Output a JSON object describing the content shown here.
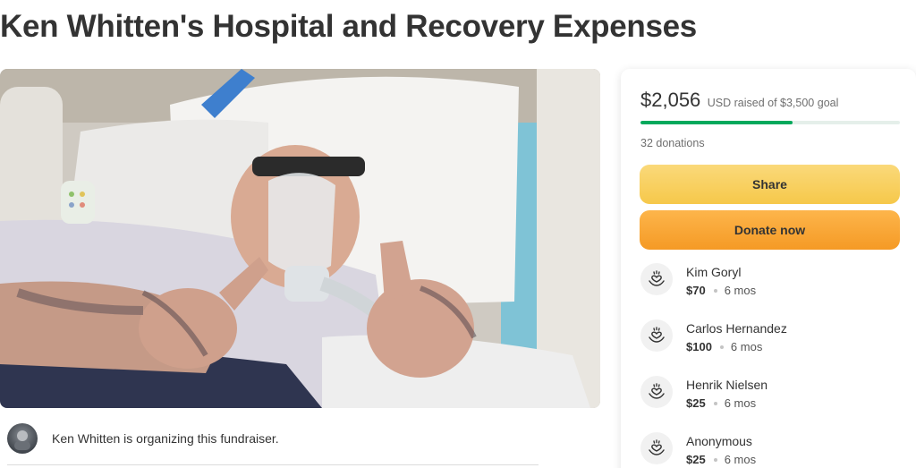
{
  "page": {
    "title": "Ken Whitten's Hospital and Recovery Expenses"
  },
  "hero": {
    "image_name": "hospital-photo"
  },
  "organizer": {
    "text": "Ken Whitten is organizing this fundraiser."
  },
  "donation_card": {
    "raised_amount": "$2,056",
    "raised_goal_text": "USD raised of $3,500 goal",
    "progress_fraction": 0.587,
    "donations_count": "32 donations",
    "share_label": "Share",
    "donate_label": "Donate now",
    "donors": [
      {
        "name": "Kim Goryl",
        "amount": "$70",
        "time": "6 mos",
        "icon": "heart-hands-icon"
      },
      {
        "name": "Carlos Hernandez",
        "amount": "$100",
        "time": "6 mos",
        "icon": "heart-hands-icon"
      },
      {
        "name": "Henrik Nielsen",
        "amount": "$25",
        "time": "6 mos",
        "icon": "heart-hands-icon"
      },
      {
        "name": "Anonymous",
        "amount": "$25",
        "time": "6 mos",
        "icon": "heart-hands-icon"
      }
    ]
  },
  "colors": {
    "progress_green": "#02a95c",
    "share_yellow": "#f6c84a",
    "donate_orange": "#f59a25"
  }
}
